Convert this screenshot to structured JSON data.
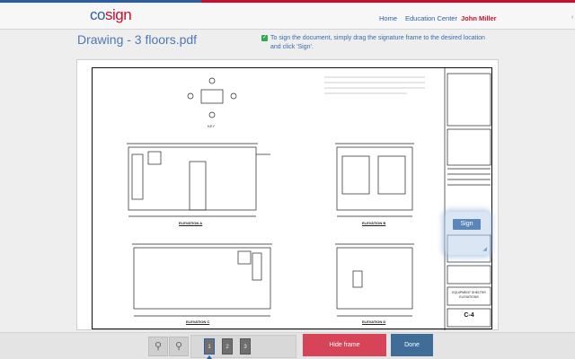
{
  "header": {
    "logo_main": "co",
    "logo_accent": "sign",
    "nav": [
      {
        "label": "Home"
      },
      {
        "label": "Education Center"
      }
    ],
    "user": "John Miller",
    "user_caret": "‹"
  },
  "document": {
    "title": "Drawing - 3 floors.pdf",
    "instruction": "To sign the document, simply drag the signature frame to the desired location and click 'Sign'.",
    "drawing": {
      "elevations": [
        "ELEVATION  A",
        "ELEVATION  B",
        "ELEVATION  C",
        "ELEVATION  D"
      ],
      "sheet_no": "C-4",
      "project_title": "EQUIPMENT SHELTER ELEVATIONS",
      "key_plan_label": "KEY"
    }
  },
  "signature_frame": {
    "sign_label": "Sign"
  },
  "toolbar": {
    "zoom_in_icon": "zoom-in-icon",
    "zoom_out_icon": "zoom-out-icon",
    "pages": [
      "1",
      "2",
      "3"
    ],
    "active_page": "1",
    "hide_frame_label": "Hide frame",
    "done_label": "Done"
  },
  "colors": {
    "brand_blue": "#2b5ea7",
    "brand_red": "#c8102e",
    "hide_frame": "#d84457",
    "done": "#3f6d98"
  }
}
